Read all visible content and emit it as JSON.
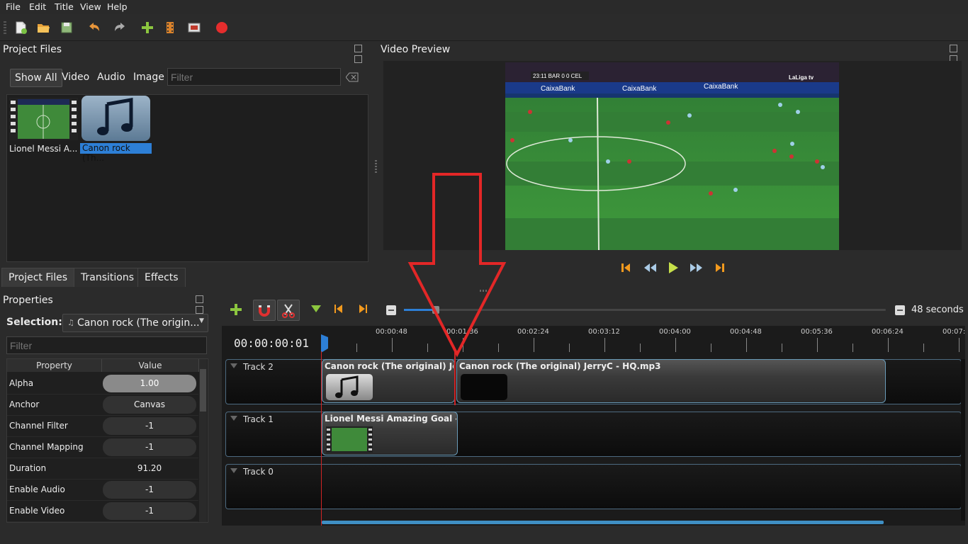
{
  "menu": [
    "File",
    "Edit",
    "Title",
    "View",
    "Help"
  ],
  "toolbar_icons": [
    "new-project-icon",
    "open-project-icon",
    "save-project-icon",
    "undo-icon",
    "redo-icon",
    "import-files-icon",
    "choose-profile-icon",
    "fullscreen-icon",
    "export-video-icon"
  ],
  "project_files": {
    "title": "Project Files",
    "filter_tabs": [
      "Show All",
      "Video",
      "Audio",
      "Image"
    ],
    "filter_placeholder": "Filter",
    "items": [
      {
        "label": "Lionel Messi A...",
        "selected": false
      },
      {
        "label": "Canon rock (Th...",
        "selected": true
      }
    ]
  },
  "bottom_tabs": [
    "Project Files",
    "Transitions",
    "Effects"
  ],
  "properties": {
    "title": "Properties",
    "selection_label": "Selection:",
    "selection_value": "Canon rock (The origin...",
    "filter_placeholder": "Filter",
    "col_property": "Property",
    "col_value": "Value",
    "rows": [
      {
        "name": "Alpha",
        "value": "1.00"
      },
      {
        "name": "Anchor",
        "value": "Canvas"
      },
      {
        "name": "Channel Filter",
        "value": "-1"
      },
      {
        "name": "Channel Mapping",
        "value": "-1"
      },
      {
        "name": "Duration",
        "value": "91.20"
      },
      {
        "name": "Enable Audio",
        "value": "-1"
      },
      {
        "name": "Enable Video",
        "value": "-1"
      }
    ]
  },
  "video_preview": {
    "title": "Video Preview",
    "scoreboard": "23:11 BAR 0 0 CEL",
    "broadcaster": "LaLiga tv",
    "ad_boards": [
      "CaixaBank",
      "CaixaBank",
      "CaixaBank"
    ]
  },
  "timeline": {
    "zoom_label": "48 seconds",
    "timecode": "00:00:00:01",
    "ruler_labels": [
      "00:00:48",
      "00:01:36",
      "00:02:24",
      "00:03:12",
      "00:04:00",
      "00:04:48",
      "00:05:36",
      "00:06:24",
      "00:07:"
    ],
    "tracks": [
      "Track 2",
      "Track 1",
      "Track 0"
    ],
    "clips": {
      "audio_a": "Canon rock (The original) Jerr...",
      "audio_b": "Canon rock (The original) JerryC - HQ.mp3",
      "video": "Lionel Messi Amazing Goal - B..."
    }
  },
  "colors": {
    "accent": "#2d7fd6",
    "annotation_arrow": "#e32727",
    "clip_border": "#6a9bb8"
  }
}
